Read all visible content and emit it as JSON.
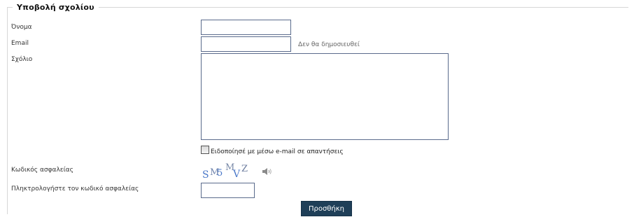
{
  "form": {
    "legend": "Υποβολή σχολίου",
    "name_label": "Όνομα",
    "email_label": "Email",
    "email_hint": "Δεν θα δημοσιευθεί",
    "comment_label": "Σχόλιο",
    "notify_label": "Ειδοποίησέ με μέσω e-mail σε απαντήσεις",
    "notify_checked": false,
    "captcha_label": "Κωδικός ασφαλείας",
    "captcha_chars": [
      "S",
      "M",
      "5",
      "M",
      "V",
      "Z"
    ],
    "captcha_input_label": "Πληκτρολογήστε τον κωδικό ασφαλείας",
    "submit_label": "Προσθήκη",
    "name_value": "",
    "email_value": "",
    "comment_value": "",
    "captcha_value": ""
  },
  "colors": {
    "captcha_blue": "#4a78c9",
    "captcha_grey": "#7a8aa8",
    "submit_bg": "#1f3f58",
    "input_border": "#5a6b8c"
  },
  "icons": {
    "audio": "speaker-icon"
  }
}
